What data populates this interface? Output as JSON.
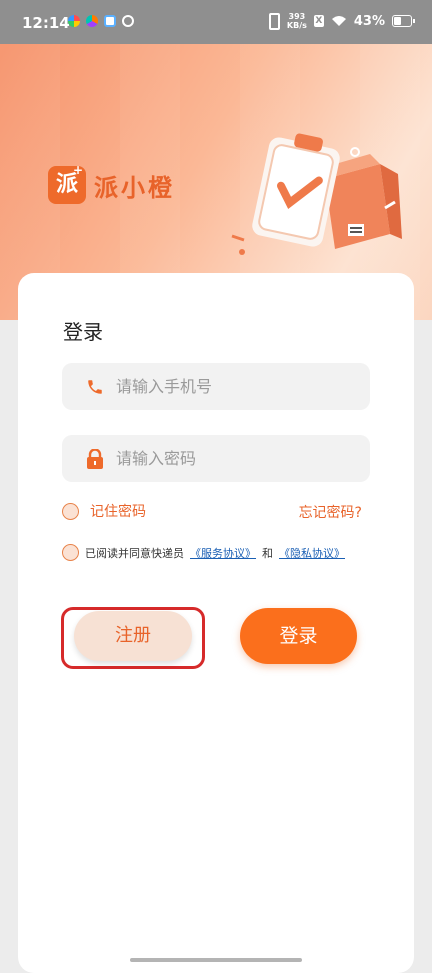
{
  "status_bar": {
    "time": "12:14",
    "net_speed_value": "393",
    "net_speed_unit": "KB/s",
    "sim_label": "X",
    "battery": "43%"
  },
  "brand": {
    "logo_char": "派",
    "logo_plus": "+",
    "name": "派小橙"
  },
  "login": {
    "title": "登录",
    "phone_placeholder": "请输入手机号",
    "password_placeholder": "请输入密码",
    "remember_label": "记住密码",
    "forgot_link": "忘记密码?",
    "agreement": {
      "prefix": "已阅读并同意快递员",
      "service_link": "《服务协议》",
      "conjunction": "和",
      "privacy_link": "《隐私协议》"
    },
    "register_button": "注册",
    "login_button": "登录"
  },
  "colors": {
    "accent": "#fb6f1c",
    "brand_orange": "#e8632a",
    "link_blue": "#1a5fb4",
    "highlight_red": "#d62a2a"
  },
  "icons": {
    "phone": "phone-icon",
    "lock": "lock-icon",
    "wifi": "wifi-icon",
    "battery": "battery-icon"
  }
}
